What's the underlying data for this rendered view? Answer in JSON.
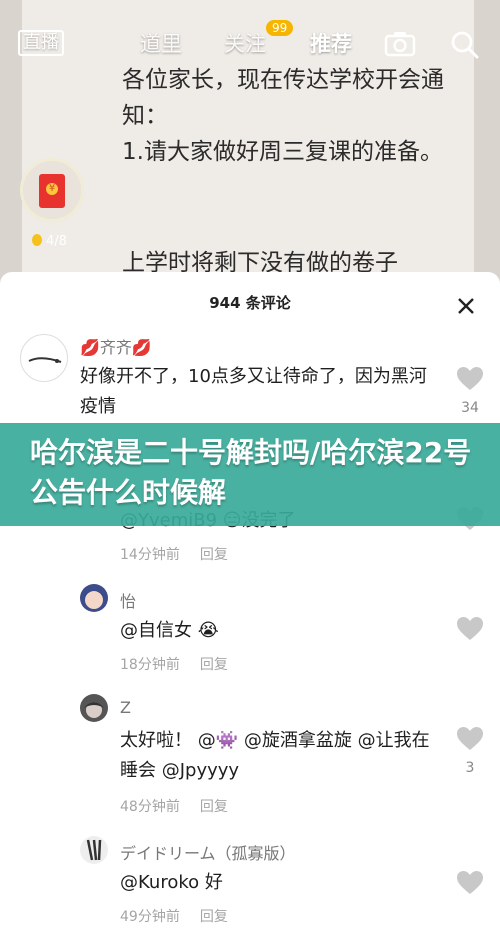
{
  "video": {
    "paper_text": "各位家长，现在传达学校开会通知：\n1.请大家做好周三复课的准备。",
    "paper_line2": "上学时将剩下没有做的卷子",
    "coin_count": "4/8"
  },
  "topbar": {
    "live_label": "直播",
    "tabs": [
      "道里",
      "关注",
      "推荐"
    ],
    "badge": "99"
  },
  "panel": {
    "title": "944 条评论"
  },
  "comments": [
    {
      "user": "💋齐齐💋",
      "text": "好像开不了，10点多又让待命了，因为黑河疫情",
      "likes": "34"
    },
    {
      "user": "",
      "text": "@YvemiB9 😑没完了",
      "time": "14分钟前",
      "reply": "回复"
    },
    {
      "user": "怡",
      "text": "@自信女 😭",
      "time": "18分钟前",
      "reply": "回复"
    },
    {
      "user": "Z",
      "text": "太好啦！ @👾 @旋酒拿盆旋 @让我在睡会 @Jpyyyy",
      "time": "48分钟前",
      "reply": "回复",
      "likes": "3"
    },
    {
      "user": "デイドリーム（孤寡版）",
      "text": "@Kuroko 好",
      "time": "49分钟前",
      "reply": "回复"
    }
  ],
  "banner": {
    "text": "哈尔滨是二十号解封吗/哈尔滨22号公告什么时候解"
  },
  "colors": {
    "banner": "#3aaa99",
    "badge": "#f6b500",
    "red_packet": "#e8322e"
  }
}
